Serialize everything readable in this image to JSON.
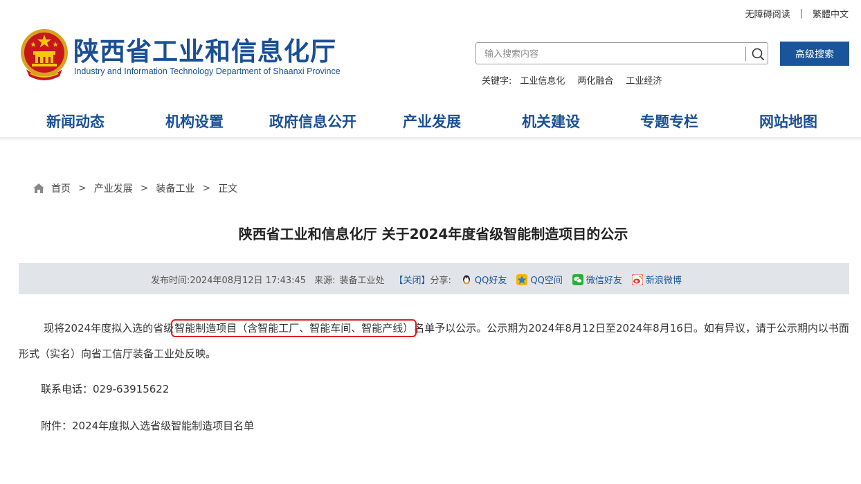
{
  "topbar": {
    "accessibility": "无障碍阅读",
    "separator": "|",
    "traditional": "繁體中文"
  },
  "header": {
    "title": "陕西省工业和信息化厅",
    "subtitle": "Industry and Information Technology Department of Shaanxi Province"
  },
  "search": {
    "placeholder": "输入搜索内容",
    "value": "",
    "advanced_label": "高级搜索"
  },
  "keywords": {
    "label": "关键字:",
    "items": [
      "工业信息化",
      "两化融合",
      "工业经济"
    ]
  },
  "nav": {
    "items": [
      "新闻动态",
      "机构设置",
      "政府信息公开",
      "产业发展",
      "机关建设",
      "专题专栏",
      "网站地图"
    ]
  },
  "breadcrumb": {
    "items": [
      "首页",
      "产业发展",
      "装备工业",
      "正文"
    ],
    "sep": ">"
  },
  "article": {
    "title": "陕西省工业和信息化厅 关于2024年度省级智能制造项目的公示",
    "meta": {
      "time_label": "发布时间:",
      "time": "2024年08月12日 17:43:45",
      "source_label": "来源:",
      "source": "装备工业处",
      "close": "【关闭】",
      "share_label": "分享:",
      "share": [
        "QQ好友",
        "QQ空间",
        "微信好友",
        "新浪微博"
      ]
    },
    "para1_pre": "现将2024年度拟入选的省级",
    "para1_highlight": "智能制造项目（含智能工厂、智能车间、智能产线）",
    "para1_post": "名单予以公示。公示期为2024年8月12日至2024年8月16日。如有异议，请于公示期内以书面形式（实名）向省工信厅装备工业处反映。",
    "phone": "联系电话：029-63915622",
    "attachment": "附件：2024年度拟入选省级智能制造项目名单"
  },
  "colors": {
    "brand": "#1a4f96",
    "button": "#1a559b",
    "highlight_border": "#e02020",
    "meta_bg": "#e1e4e8"
  }
}
